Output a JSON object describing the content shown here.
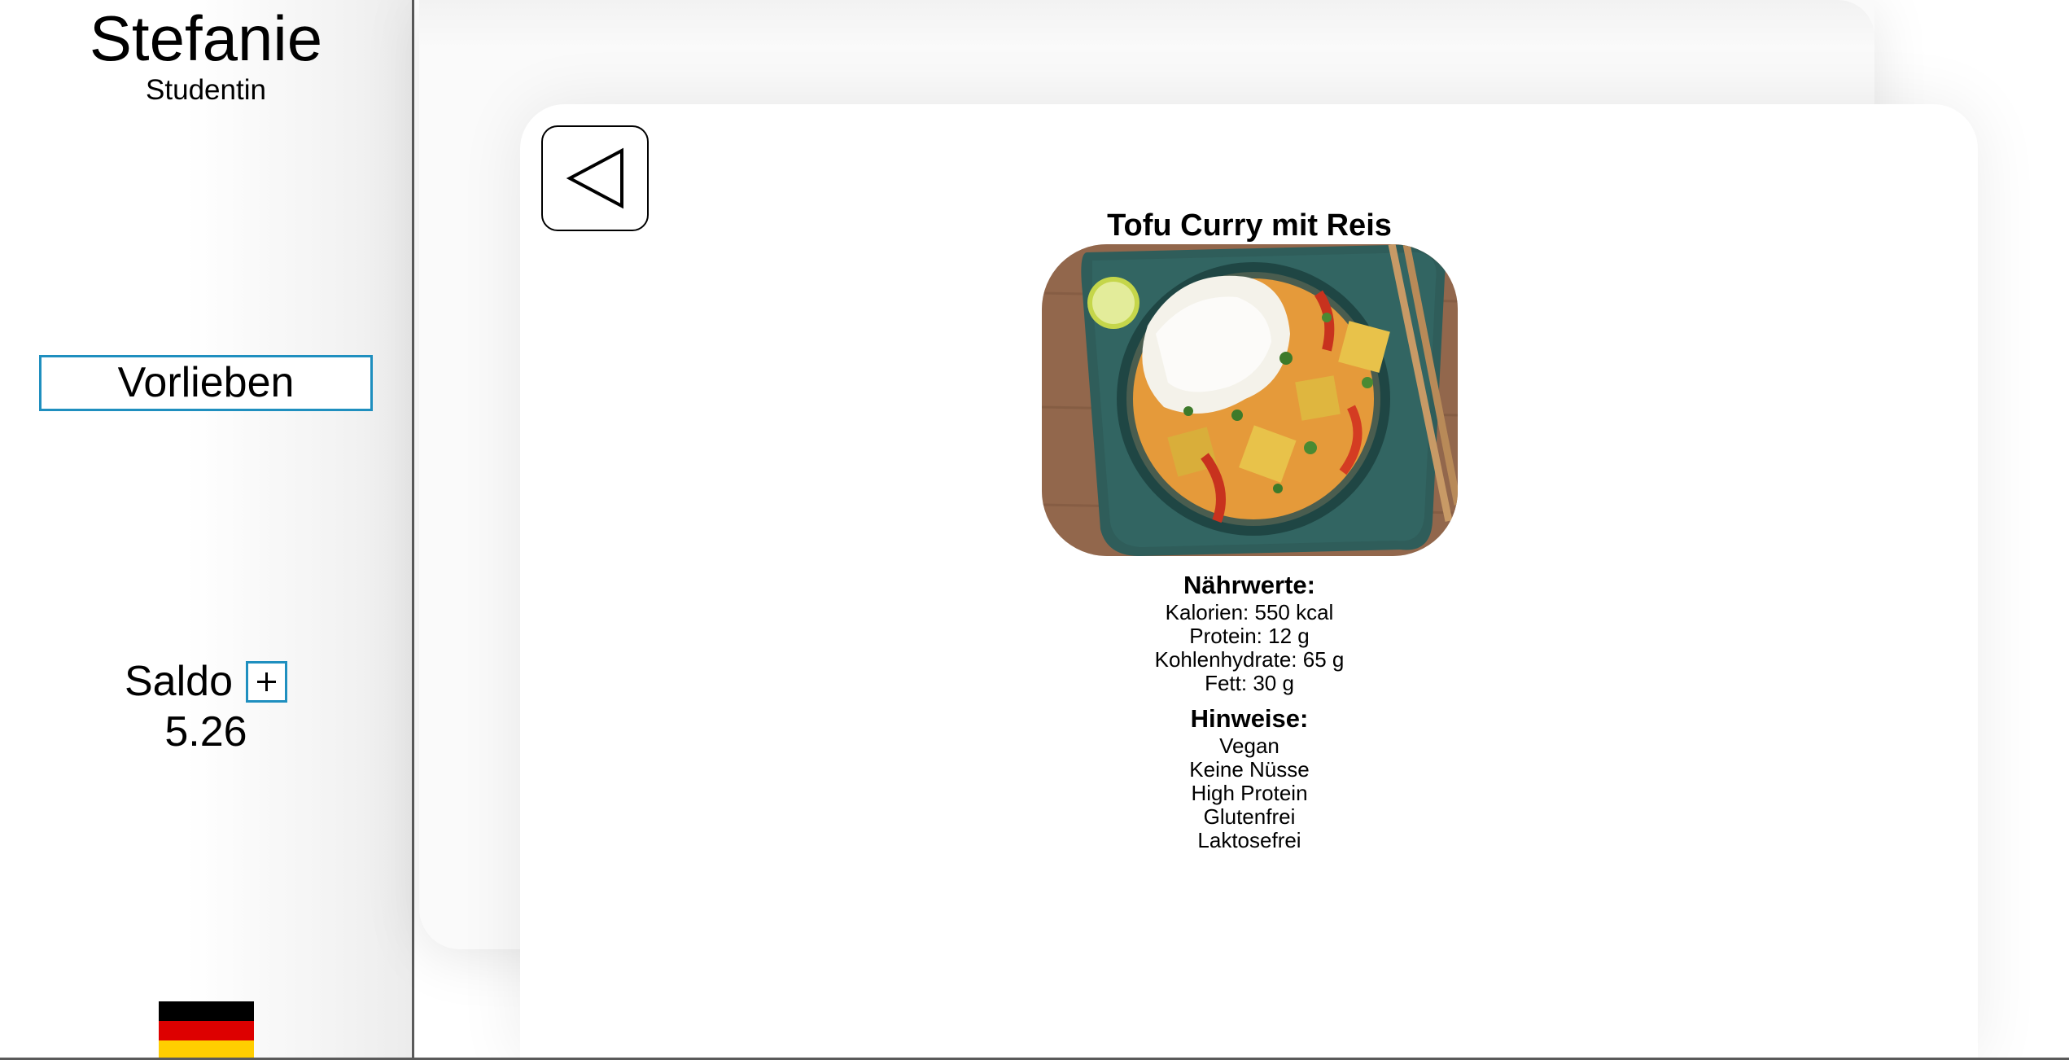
{
  "sidebar": {
    "user_name": "Stefanie",
    "user_role": "Studentin",
    "preferences_label": "Vorlieben",
    "balance_label": "Saldo",
    "balance_value": "5.26",
    "language_flag": "germany-flag-icon"
  },
  "dish": {
    "title": "Tofu Curry mit Reis",
    "image": "tofu-curry-photo",
    "nutrition_heading": "Nährwerte:",
    "nutrition": [
      "Kalorien: 550 kcal",
      "Protein: 12 g",
      "Kohlenhydrate: 65 g",
      "Fett: 30 g"
    ],
    "notes_heading": "Hinweise:",
    "notes": [
      "Vegan",
      "Keine Nüsse",
      "High Protein",
      "Glutenfrei",
      "Laktosefrei"
    ]
  },
  "icons": {
    "back": "triangle-left-icon",
    "add_balance": "plus-icon"
  },
  "colors": {
    "accent_border": "#1f8fbf",
    "divider": "#5a5a5a",
    "flag_black": "#000000",
    "flag_red": "#dd0000",
    "flag_gold": "#ffce00"
  }
}
